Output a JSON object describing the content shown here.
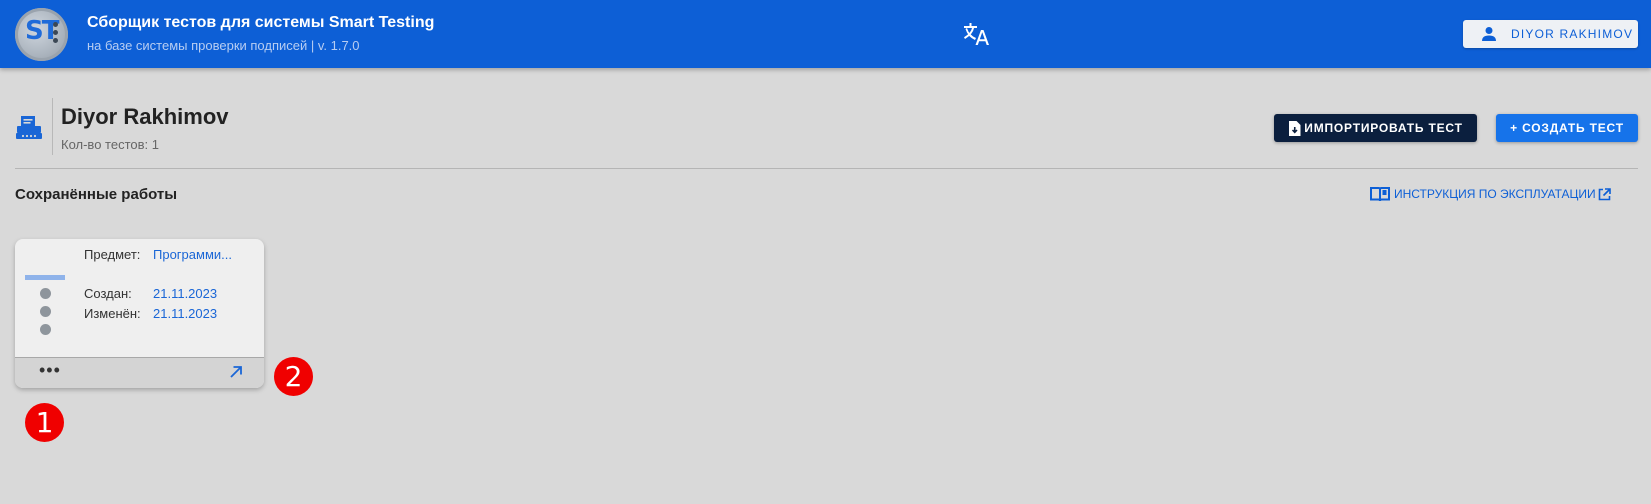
{
  "topbar": {
    "app_title": "Сборщик тестов для системы Smart Testing",
    "app_subtitle": "на базе системы проверки подписей | v. 1.7.0",
    "logo_text": "ST",
    "translate_icon": "translate-icon",
    "user_button_label": "DIYOR RAKHIMOV",
    "user_icon": "person-icon",
    "color": "#0d5fd6"
  },
  "header": {
    "icon": "printer-icon",
    "title": "Diyor Rakhimov",
    "tests_count": "Кол-во тестов: 1",
    "import_button_label": "ИМПОРТИРОВАТЬ ТЕСТ",
    "create_button_label": "+ СОЗДАТЬ ТЕСТ"
  },
  "saved": {
    "section_title": "Сохранённые работы",
    "manual_link_label": "ИНСТРУКЦИЯ ПО ЭКСПЛУАТАЦИИ"
  },
  "card": {
    "subject_label": "Предмет:",
    "subject_value": "Программи...",
    "created_label": "Создан:",
    "created_value": "21.11.2023",
    "modified_label": "Изменён:",
    "modified_value": "21.11.2023",
    "more_label": "•••"
  },
  "markers": {
    "first": "1",
    "second": "2"
  }
}
